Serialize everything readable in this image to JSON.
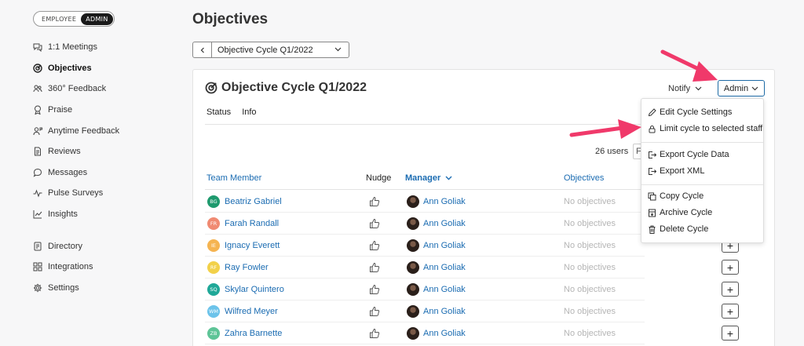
{
  "sidebar": {
    "toggle": {
      "employee": "EMPLOYEE",
      "admin": "ADMIN"
    },
    "items": [
      {
        "label": "1:1 Meetings",
        "icon": "meetings-icon"
      },
      {
        "label": "Objectives",
        "icon": "target-icon",
        "active": true
      },
      {
        "label": "360° Feedback",
        "icon": "people-icon"
      },
      {
        "label": "Praise",
        "icon": "award-icon"
      },
      {
        "label": "Anytime Feedback",
        "icon": "person-feedback-icon"
      },
      {
        "label": "Reviews",
        "icon": "document-icon"
      },
      {
        "label": "Messages",
        "icon": "chat-icon"
      },
      {
        "label": "Pulse Surveys",
        "icon": "pulse-icon"
      },
      {
        "label": "Insights",
        "icon": "chart-icon"
      },
      {
        "label": "Directory",
        "icon": "directory-icon"
      },
      {
        "label": "Integrations",
        "icon": "grid-icon"
      },
      {
        "label": "Settings",
        "icon": "gear-icon"
      }
    ]
  },
  "page": {
    "title": "Objectives",
    "cycle_select": "Objective Cycle Q1/2022"
  },
  "card": {
    "title": "Objective Cycle Q1/2022",
    "notify": "Notify",
    "admin": "Admin",
    "tabs": [
      "Status",
      "Info"
    ],
    "users_count": "26 users",
    "filter_stub": "Fi"
  },
  "table": {
    "headers": {
      "member": "Team Member",
      "nudge": "Nudge",
      "manager": "Manager",
      "objectives": "Objectives"
    },
    "rows": [
      {
        "initials": "BG",
        "color": "#1f9a6e",
        "name": "Beatriz Gabriel",
        "manager": "Ann Goliak",
        "objectives": "No objectives"
      },
      {
        "initials": "FR",
        "color": "#f08a72",
        "name": "Farah Randall",
        "manager": "Ann Goliak",
        "objectives": "No objectives"
      },
      {
        "initials": "IE",
        "color": "#f5b451",
        "name": "Ignacy Everett",
        "manager": "Ann Goliak",
        "objectives": "No objectives"
      },
      {
        "initials": "RF",
        "color": "#f2d14a",
        "name": "Ray Fowler",
        "manager": "Ann Goliak",
        "objectives": "No objectives"
      },
      {
        "initials": "SQ",
        "color": "#1fa898",
        "name": "Skylar Quintero",
        "manager": "Ann Goliak",
        "objectives": "No objectives"
      },
      {
        "initials": "WM",
        "color": "#6cc3ea",
        "name": "Wilfred Meyer",
        "manager": "Ann Goliak",
        "objectives": "No objectives"
      },
      {
        "initials": "ZB",
        "color": "#5ec497",
        "name": "Zahra Barnette",
        "manager": "Ann Goliak",
        "objectives": "No objectives"
      }
    ]
  },
  "admin_menu": {
    "items": [
      {
        "label": "Edit Cycle Settings",
        "icon": "pencil-icon"
      },
      {
        "label": "Limit cycle to selected staff",
        "icon": "lock-icon"
      },
      {
        "label": "Export Cycle Data",
        "icon": "export-icon"
      },
      {
        "label": "Export XML",
        "icon": "export-icon"
      },
      {
        "label": "Copy Cycle",
        "icon": "copy-icon"
      },
      {
        "label": "Archive Cycle",
        "icon": "archive-icon"
      },
      {
        "label": "Delete Cycle",
        "icon": "trash-icon"
      }
    ]
  },
  "colors": {
    "accent": "#1b6cb2",
    "arrow": "#f0396a"
  }
}
